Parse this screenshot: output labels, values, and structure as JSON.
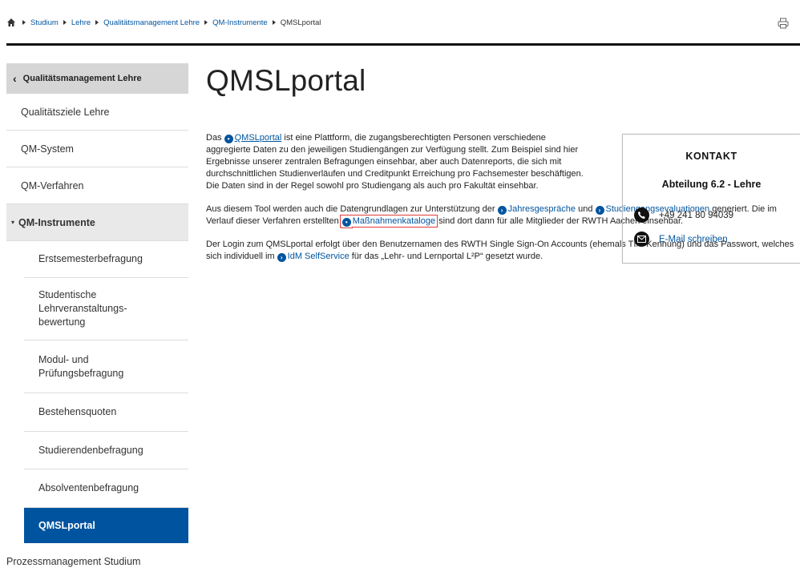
{
  "breadcrumb": {
    "items": [
      "Studium",
      "Lehre",
      "Qualitätsmanagement Lehre",
      "QM-Instrumente"
    ],
    "current": "QMSLportal"
  },
  "sidebar": {
    "back_label": "Qualitätsmanagement Lehre",
    "items": [
      "Qualitätsziele Lehre",
      "QM-System",
      "QM-Verfahren"
    ],
    "active_parent": "QM-Instrumente",
    "sub_items": [
      "Erstsemesterbefragung",
      "Studentische Lehrveranstaltungs-bewertung",
      "Modul- und Prüfungsbefragung",
      "Bestehensquoten",
      "Studierendenbefragung",
      "Absolventenbefragung",
      "QMSLportal"
    ],
    "last_item": "Prozessmanagement Studium"
  },
  "page": {
    "title": "QMSLportal",
    "p1": {
      "pre": "Das ",
      "link": "QMSLportal",
      "post": " ist eine Plattform, die zugangsberechtigten Personen verschiedene aggregierte Daten zu den jeweiligen Studiengängen zur Verfügung stellt. Zum Beispiel sind hier Ergebnisse unserer zentralen Befragungen einsehbar, aber auch Datenreports, die sich mit durchschnittlichen Studienverläufen und Creditpunkt Erreichung pro Fachsemester beschäftigen. Die Daten sind in der Regel sowohl pro Studiengang als auch pro Fakultät einsehbar."
    },
    "p2": {
      "a": "Aus diesem Tool werden auch die Datengrundlagen zur Unterstützung der ",
      "link1": "Jahresgespräche",
      "b": " und ",
      "link2": "Studiengangsevaluationen",
      "c": " generiert. Die im Verlauf dieser Verfahren erstellten ",
      "link3": "Maßnahmenkataloge",
      "d": " sind dort dann für alle Mitglieder der RWTH Aachen einsehbar."
    },
    "p3": {
      "a": "Der Login zum QMSLportal erfolgt über den Benutzernamen des RWTH Single Sign-On Accounts (ehemals TIM-Kennung) und das Passwort, welches sich individuell im ",
      "link": "IdM SelfService",
      "b": " für das „Lehr- und Lernportal L²P“ gesetzt wurde."
    }
  },
  "contact": {
    "title": "KONTAKT",
    "department": "Abteilung 6.2 - Lehre",
    "phone": "+49 241 80 94039",
    "email_label": "E-Mail schreiben"
  },
  "icons": {
    "home": "home-icon",
    "print": "print-icon",
    "phone": "phone-icon",
    "mail": "mail-icon",
    "link_arrow": "arrow-circle-icon",
    "lock": "lock-icon"
  },
  "colors": {
    "accent": "#00549f",
    "highlight": "#e23b3b"
  }
}
